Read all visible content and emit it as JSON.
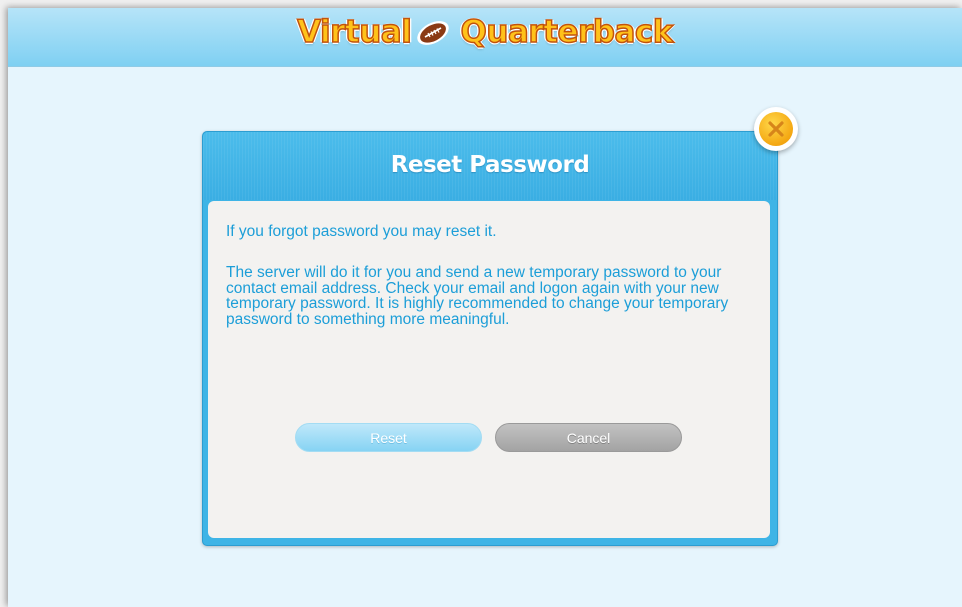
{
  "app": {
    "logo": {
      "word_left": "Virtual",
      "word_right": "Quarterback",
      "ball_icon": "football-icon"
    }
  },
  "dialog": {
    "title": "Reset Password",
    "paragraph1": "If you forgot password you may reset it.",
    "paragraph2": "The server will do it for you and send a new temporary password to your contact email address. Check your email and logon again with your new temporary password. It is highly recommended to change your temporary password to something more meaningful.",
    "reset_label": "Reset",
    "cancel_label": "Cancel",
    "close_icon": "close-icon"
  },
  "colors": {
    "header_gradient_top": "#b6e4f8",
    "dialog_blue": "#3eb4e6",
    "body_text": "#1c9ed8",
    "close_orange": "#f4a712",
    "logo_yellow": "#ffc21a"
  }
}
